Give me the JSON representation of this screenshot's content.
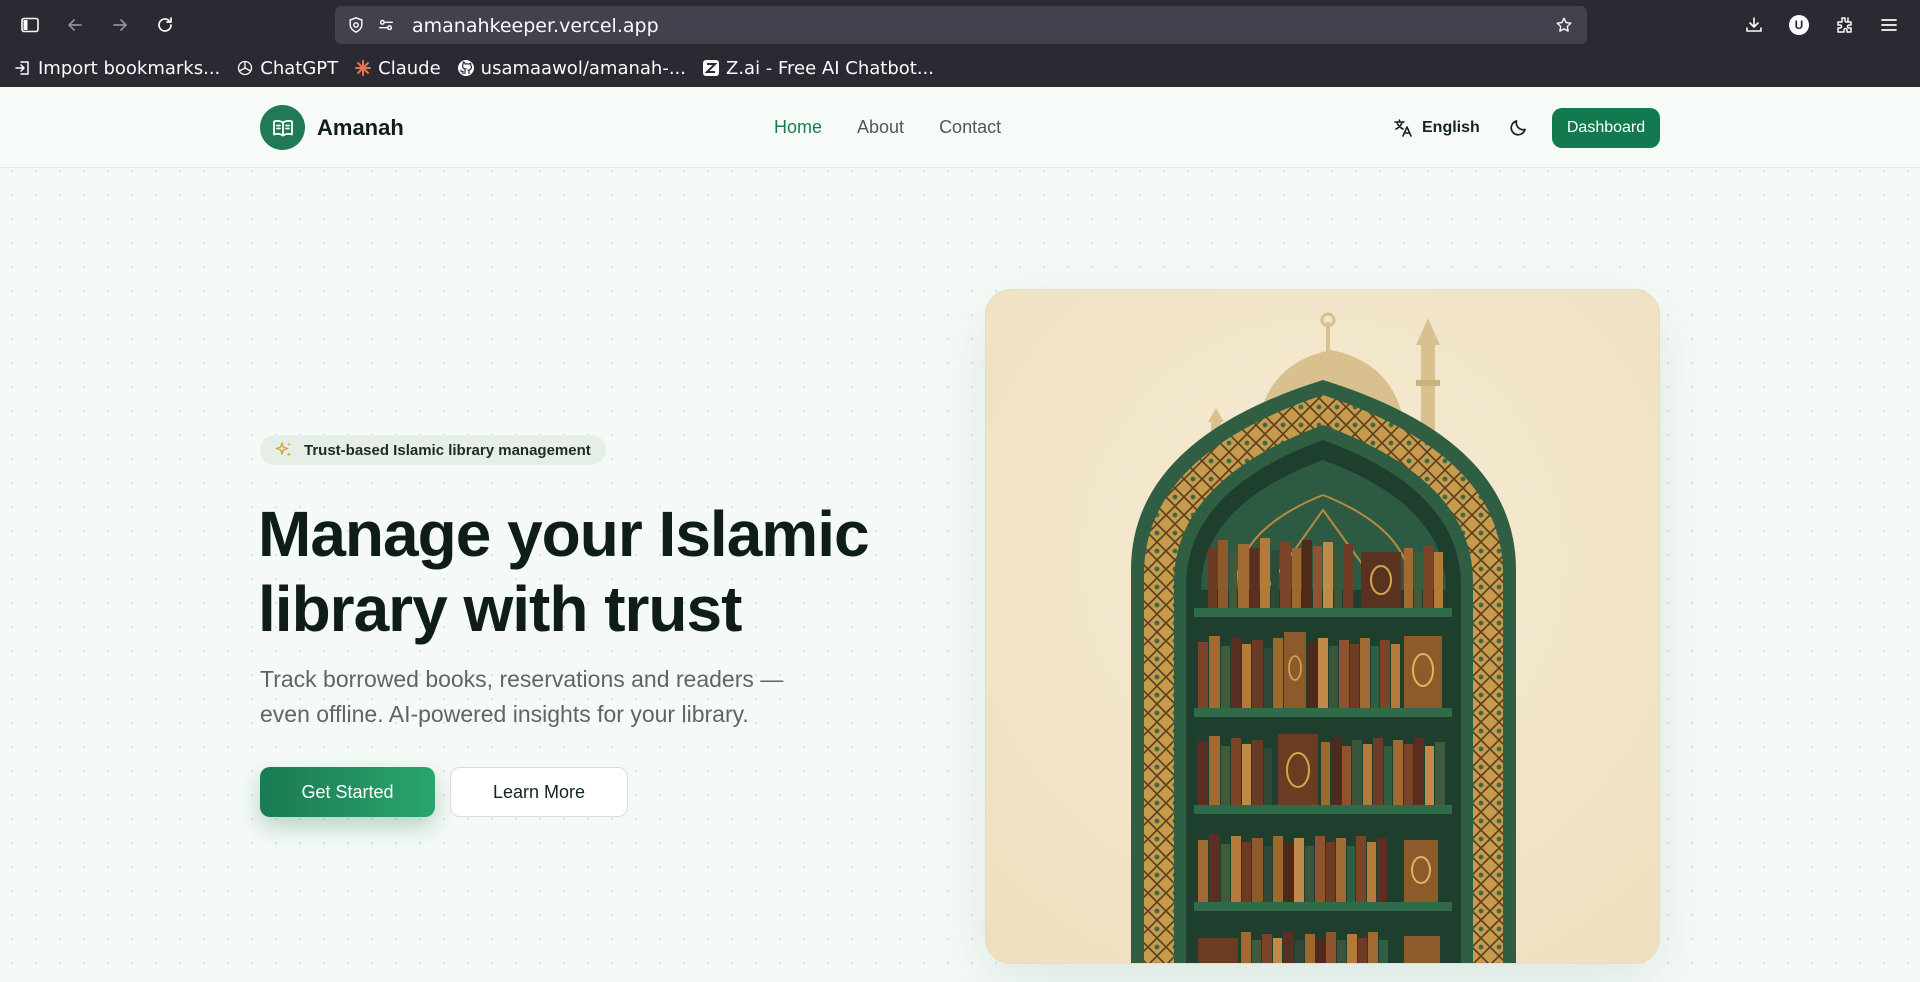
{
  "browser": {
    "url": "amanahkeeper.vercel.app",
    "profile_initial": "U",
    "bookmarks": [
      {
        "label": "Import bookmarks...",
        "icon": "import-icon"
      },
      {
        "label": "ChatGPT",
        "icon": "chatgpt-icon"
      },
      {
        "label": "Claude",
        "icon": "claude-icon"
      },
      {
        "label": "usamaawol/amanah-...",
        "icon": "github-icon"
      },
      {
        "label": "Z.ai - Free AI Chatbot...",
        "icon": "zai-icon"
      }
    ]
  },
  "header": {
    "brand": "Amanah",
    "nav": [
      {
        "label": "Home",
        "active": true
      },
      {
        "label": "About",
        "active": false
      },
      {
        "label": "Contact",
        "active": false
      }
    ],
    "language": "English",
    "dashboard_label": "Dashboard"
  },
  "hero": {
    "badge": "Trust-based Islamic library management",
    "title_line1": "Manage your Islamic",
    "title_line2": "library with trust",
    "subtitle_line1": "Track borrowed books, reservations and readers —",
    "subtitle_line2": "even offline. AI-powered insights for your library.",
    "primary_cta": "Get Started",
    "secondary_cta": "Learn More",
    "image_subject": "mosque-arch-bookshelf-illustration"
  },
  "colors": {
    "brand_green": "#137a50",
    "chrome_bg": "#2b2a33",
    "page_bg": "#f6faf7"
  }
}
